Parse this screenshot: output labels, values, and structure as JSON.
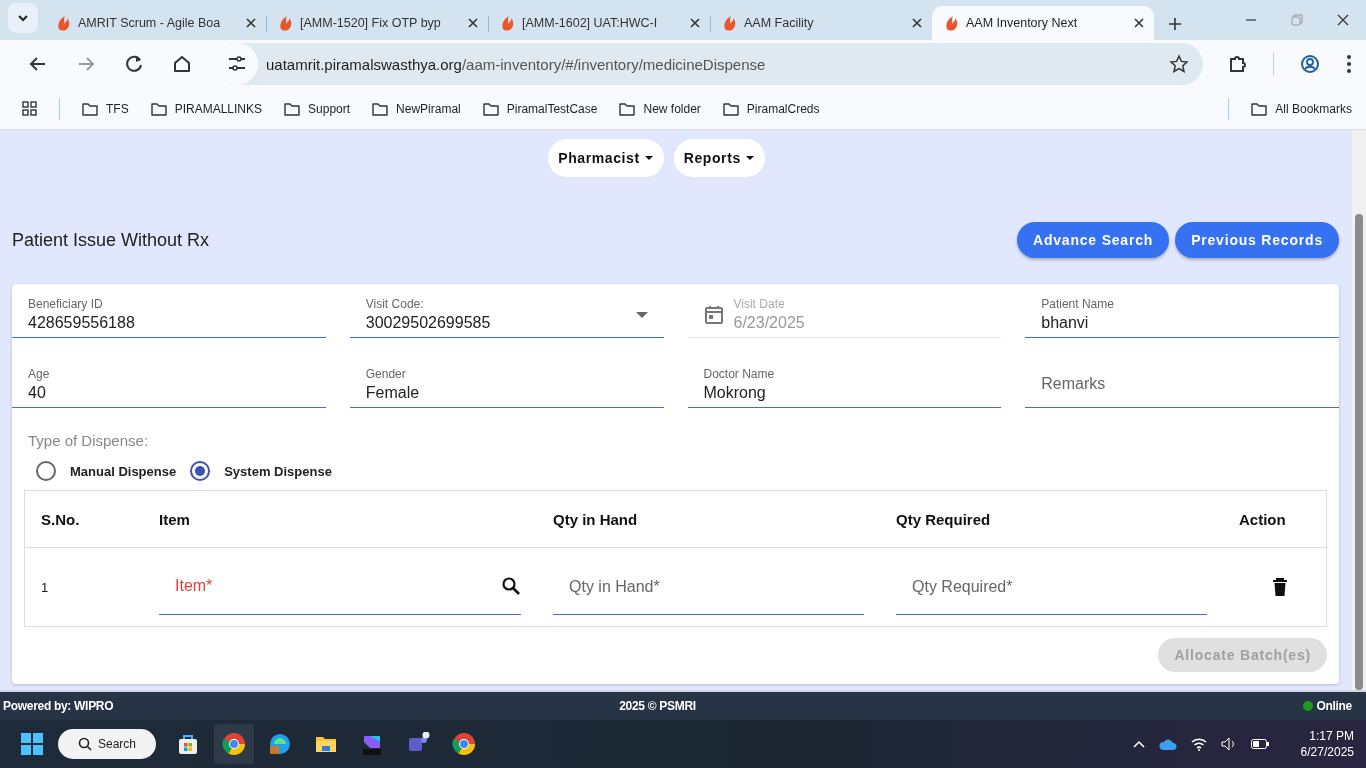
{
  "browser": {
    "tabs": [
      {
        "title": "AMRIT Scrum - Agile Boa",
        "selected": false
      },
      {
        "title": "[AMM-1520] Fix OTP byp",
        "selected": false
      },
      {
        "title": "[AMM-1602] UAT:HWC-I",
        "selected": false
      },
      {
        "title": "AAM Facility",
        "selected": false
      },
      {
        "title": "AAM Inventory Next",
        "selected": true
      }
    ],
    "address_host": "uatamrit.piramalswasthya.org",
    "address_path": "/aam-inventory/#/inventory/medicineDispense",
    "bookmarks": [
      "TFS",
      "PIRAMALLINKS",
      "Support",
      "NewPiramal",
      "PiramalTestCase",
      "New folder",
      "PiramalCreds"
    ],
    "all_bookmarks": "All Bookmarks"
  },
  "nav": [
    "Pharmacist",
    "Reports"
  ],
  "page_title": "Patient Issue Without Rx",
  "actions": [
    "Advance Search",
    "Previous Records"
  ],
  "fields": [
    {
      "kind": "text",
      "label": "Beneficiary ID",
      "value": "428659556188"
    },
    {
      "kind": "select",
      "label": "Visit Code:",
      "value": "30029502699585"
    },
    {
      "kind": "date",
      "label": "Visit Date",
      "value": "6/23/2025",
      "disabled": true
    },
    {
      "kind": "text",
      "label": "Patient Name",
      "value": "bhanvi"
    },
    {
      "kind": "text",
      "label": "Age",
      "value": "40"
    },
    {
      "kind": "text",
      "label": "Gender",
      "value": "Female"
    },
    {
      "kind": "text",
      "label": "Doctor Name",
      "value": "Mokrong"
    },
    {
      "kind": "input",
      "placeholder": "Remarks"
    }
  ],
  "dispense": {
    "label": "Type of Dispense:",
    "options": [
      {
        "label": "Manual Dispense",
        "selected": false
      },
      {
        "label": "System Dispense",
        "selected": true
      }
    ]
  },
  "table": {
    "columns": [
      "S.No.",
      "Item",
      "Qty in Hand",
      "Qty Required",
      "Action"
    ],
    "rows": [
      {
        "sno": "1",
        "item_placeholder": "Item*",
        "item_invalid": true,
        "qty_in_hand_placeholder": "Qty in Hand*",
        "qty_required_placeholder": "Qty Required*"
      }
    ]
  },
  "allocate": {
    "label": "Allocate Batch(es)",
    "disabled": true
  },
  "footer": {
    "left": "Powered by: WIPRO",
    "center": "2025 © PSMRI",
    "status": "Online"
  },
  "taskbar": {
    "search": "Search",
    "time": "1:17 PM",
    "date": "6/27/2025"
  }
}
